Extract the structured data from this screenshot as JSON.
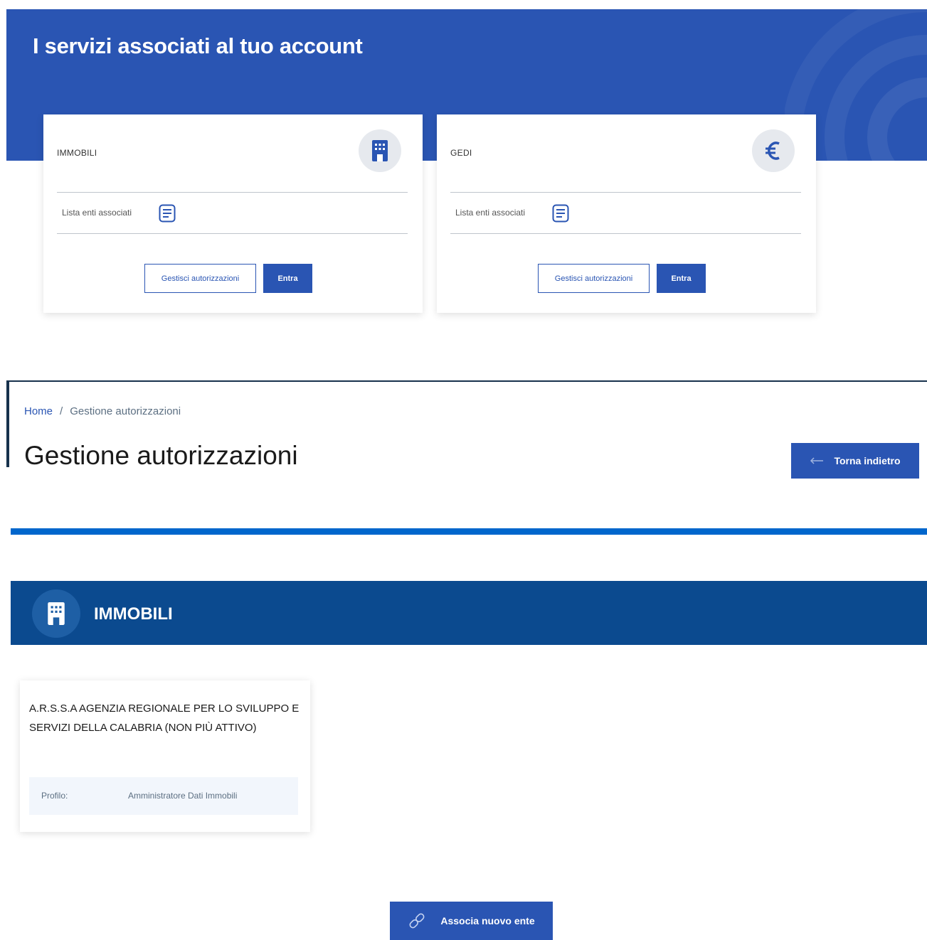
{
  "services": {
    "title": "I servizi associati al tuo account",
    "cards": [
      {
        "name": "IMMOBILI",
        "icon": "building-icon",
        "list_label": "Lista enti associati",
        "manage_label": "Gestisci autorizzazioni",
        "enter_label": "Entra"
      },
      {
        "name": "GEDI",
        "icon": "euro-icon",
        "list_label": "Lista enti associati",
        "manage_label": "Gestisci autorizzazioni",
        "enter_label": "Entra"
      }
    ]
  },
  "breadcrumb": {
    "home": "Home",
    "separator": "/",
    "current": "Gestione autorizzazioni"
  },
  "page": {
    "title": "Gestione autorizzazioni",
    "back_label": "Torna indietro"
  },
  "section": {
    "title": "IMMOBILI",
    "icon": "building-icon"
  },
  "ente": {
    "name": "A.R.S.S.A AGENZIA REGIONALE PER LO SVILUPPO E SERVIZI DELLA CALABRIA (NON PIÙ ATTIVO)",
    "profile_label": "Profilo:",
    "profile_value": "Amministratore Dati Immobili"
  },
  "actions": {
    "associate_label": "Associa nuovo ente"
  },
  "colors": {
    "primary": "#2a55b3",
    "dark_navy": "#0b4a8f",
    "accent_rule": "#0066cc"
  }
}
